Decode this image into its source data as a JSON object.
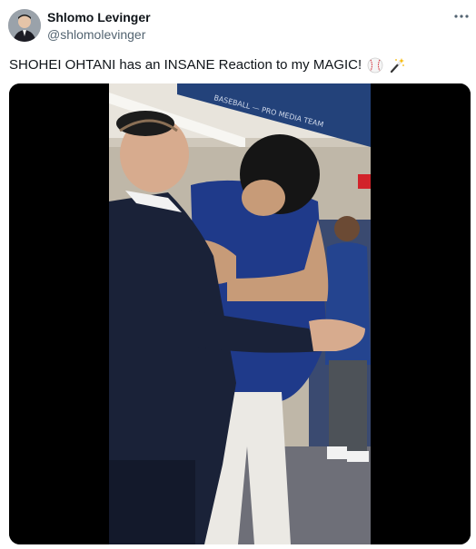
{
  "author": {
    "display_name": "Shlomo Levinger",
    "handle": "@shlomolevinger"
  },
  "menu": {
    "more_icon": "more-horizontal-icon"
  },
  "tweet": {
    "text": "SHOHEI OHTANI has an INSANE Reaction to my MAGIC!",
    "emojis": [
      "baseball-emoji",
      "magic-wand-emoji"
    ]
  },
  "media": {
    "kind": "video",
    "background_text": "BASEBALL — PRO MEDIA TEAM",
    "colors": {
      "dodger_blue": "#1f3a8a",
      "suit": "#1a2238",
      "wall": "#d9d2c4"
    }
  }
}
